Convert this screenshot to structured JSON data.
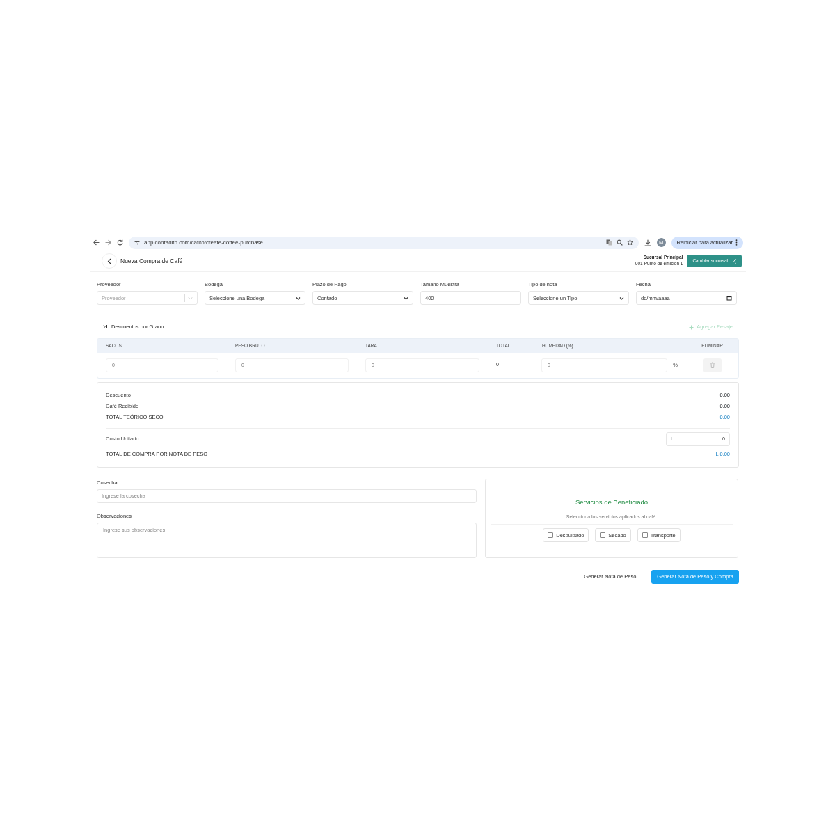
{
  "browser": {
    "url": "app.contadito.com/cafito/create-coffee-purchase",
    "avatar": "M",
    "update_button": "Reiniciar para actualizar"
  },
  "header": {
    "title": "Nueva Compra de Café",
    "branch_name": "Sucursal Principal",
    "branch_point": "001-Punto de emisión 1",
    "change_branch": "Cambiar sucursal"
  },
  "fields": [
    {
      "label": "Proveedor",
      "kind": "combo",
      "placeholder": "Proveedor"
    },
    {
      "label": "Bodega",
      "kind": "select",
      "value": "Seleccione una Bodega"
    },
    {
      "label": "Plazo de Pago",
      "kind": "select",
      "value": "Contado"
    },
    {
      "label": "Tamaño Muestra",
      "kind": "text",
      "value": "400"
    },
    {
      "label": "Tipo de nota",
      "kind": "select",
      "value": "Seleccione un Tipo"
    },
    {
      "label": "Fecha",
      "kind": "date",
      "value": "dd/mm/aaaa"
    }
  ],
  "discounts": {
    "toggle": "Descuentos por Grano",
    "add_button": "Agregar Pesaje"
  },
  "weighings": {
    "columns": [
      "SACOS",
      "PESO BRUTO",
      "TARA",
      "TOTAL",
      "HUMEDAD (%)",
      "ELIMINAR"
    ],
    "rows": [
      {
        "inputs": [
          {
            "placeholder": "0"
          },
          {
            "placeholder": "0"
          },
          {
            "placeholder": "0"
          }
        ],
        "total": "0",
        "humidity": {
          "placeholder": "0"
        },
        "unit": "%"
      }
    ]
  },
  "summary": {
    "lines": [
      {
        "label": "Descuento",
        "value": "0.00",
        "kind": "plain"
      },
      {
        "label": "Café Recibido",
        "value": "0.00",
        "kind": "plain"
      },
      {
        "label": "TOTAL TEÓRICO SECO",
        "value": "0.00",
        "kind": "total"
      }
    ],
    "unit_cost": {
      "label": "Costo Unitario",
      "currency": "L",
      "value": "0"
    },
    "total": {
      "label": "TOTAL DE COMPRA POR NOTA DE PESO",
      "value": "L 0.00"
    }
  },
  "harvest": {
    "label": "Cosecha",
    "placeholder": "Ingrese la cosecha"
  },
  "notes": {
    "label": "Observaciones",
    "placeholder": "Ingrese sus observaciones"
  },
  "services": {
    "title": "Servicios de Beneficiado",
    "subtitle": "Selecciona los servicios aplicados al café.",
    "options": [
      {
        "label": "Despulpado",
        "checked": false
      },
      {
        "label": "Secado",
        "checked": false
      },
      {
        "label": "Transporte",
        "checked": false
      }
    ]
  },
  "actions": [
    {
      "label": "Generar Nota de Peso",
      "kind": "secondary"
    },
    {
      "label": "Generar Nota de Peso y Compra",
      "kind": "primary"
    }
  ]
}
